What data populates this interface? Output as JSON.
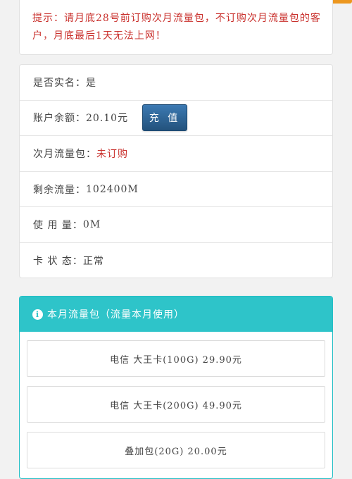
{
  "notice": {
    "text": "提示：请月底28号前订购次月流量包，不订购次月流量包的客户，月底最后1天无法上网！"
  },
  "account": {
    "rows": [
      {
        "label": "是否实名：",
        "value": "是"
      },
      {
        "label": "账户余额：",
        "value": "20.10元"
      },
      {
        "label": "次月流量包：",
        "value": "未订购"
      },
      {
        "label": "剩余流量：",
        "value": "102400M"
      },
      {
        "label": "使 用 量：",
        "value": "0M"
      },
      {
        "label": "卡 状 态：",
        "value": "正常"
      }
    ],
    "recharge_label": "充 值"
  },
  "packages": {
    "header_icon": "info-icon",
    "header_title": "本月流量包（流量本月使用）",
    "items": [
      {
        "label": "电信 大王卡(100G) 29.90元"
      },
      {
        "label": "电信 大王卡(200G) 49.90元"
      },
      {
        "label": "叠加包(20G) 20.00元"
      }
    ]
  },
  "colors": {
    "notice_text": "#c9302c",
    "unsubscribed_text": "#c9302c",
    "recharge_button": "#2b6aa5",
    "panel_header": "#2ec4c9",
    "top_tab": "#ec971f"
  }
}
